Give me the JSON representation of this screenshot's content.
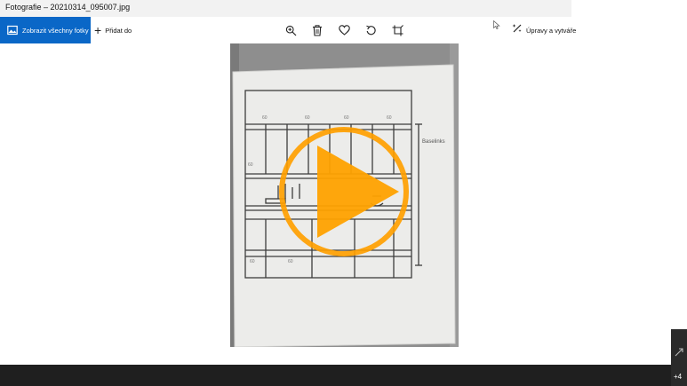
{
  "window": {
    "title": "Fotografie – 20210314_095007.jpg"
  },
  "toolbar": {
    "show_all_label": "Zobrazit všechny fotky",
    "add_label": "Přidat do",
    "edit_label": "Úpravy a vytváření",
    "icons": [
      "zoom-icon",
      "delete-icon",
      "favorite-icon",
      "rotate-icon",
      "crop-icon"
    ]
  },
  "photo": {
    "sketch_label": "Baselinks"
  },
  "filmstrip": {
    "more_count": "+4"
  },
  "colors": {
    "accent": "#0a67c7",
    "play_overlay": "#ff9f00",
    "bottom_bar": "#1f1f1f"
  }
}
